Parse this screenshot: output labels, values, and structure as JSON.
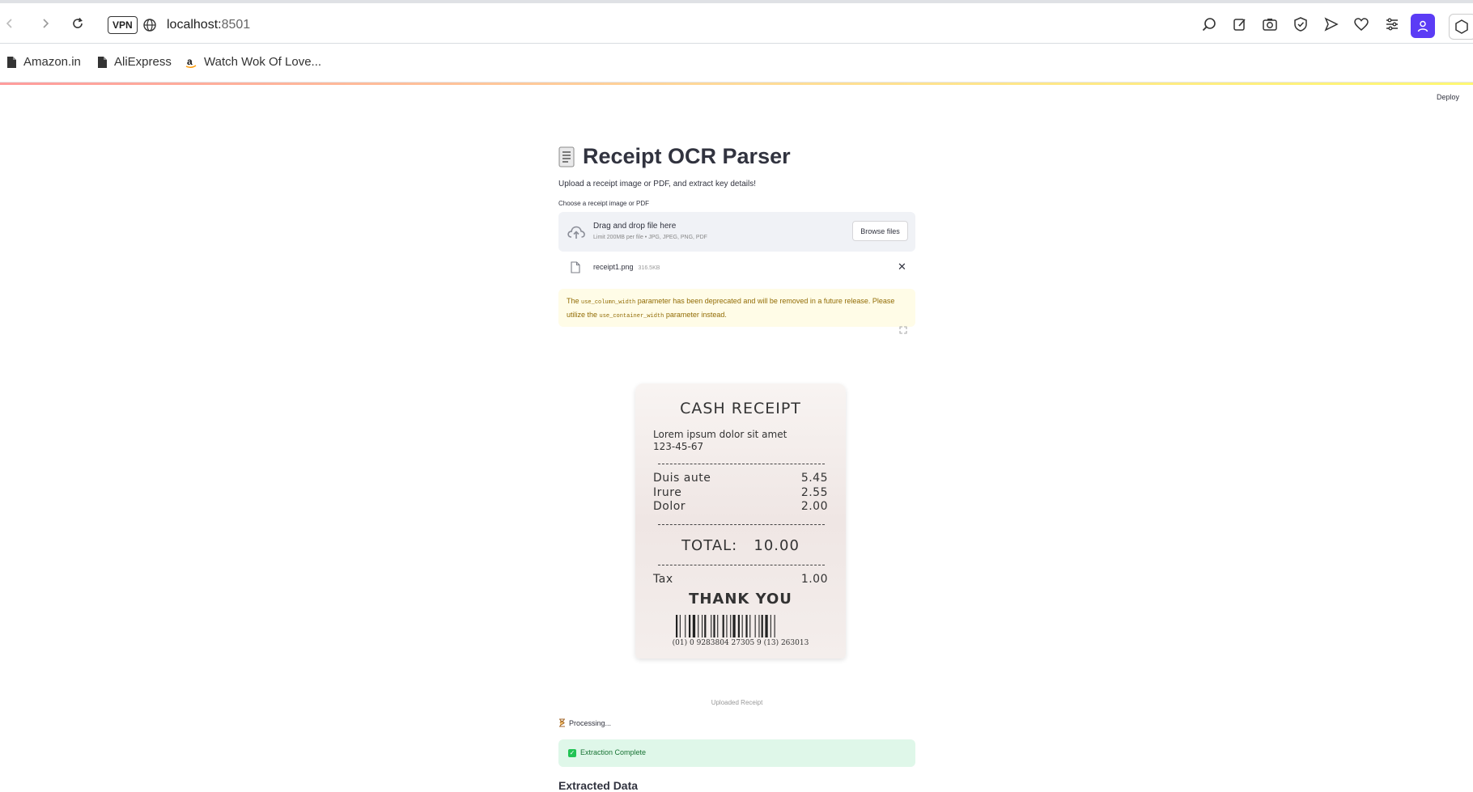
{
  "browser": {
    "vpn_label": "VPN",
    "url_host": "localhost:",
    "url_port": "8501",
    "bookmarks": [
      {
        "label": "Amazon.in",
        "icon": "page-icon"
      },
      {
        "label": "AliExpress",
        "icon": "page-icon"
      },
      {
        "label": "Watch Wok Of Love...",
        "icon": "amazon-icon"
      }
    ]
  },
  "app": {
    "deploy_label": "Deploy",
    "title": "Receipt OCR Parser",
    "subtitle": "Upload a receipt image or PDF, and extract key details!",
    "uploader": {
      "label": "Choose a receipt image or PDF",
      "drag_text": "Drag and drop file here",
      "limit_text": "Limit 200MB per file • JPG, JPEG, PNG, PDF",
      "browse_label": "Browse files"
    },
    "file": {
      "name": "receipt1.png",
      "size": "316.5KB"
    },
    "warning": {
      "t1": "The ",
      "code1": "use_column_width",
      "t2": " parameter has been deprecated and will be removed in a future release. Please utilize the ",
      "code2": "use_container_width",
      "t3": " parameter instead."
    },
    "receipt": {
      "title": "CASH RECEIPT",
      "line1": "Lorem ipsum dolor sit amet",
      "line2": "123-45-67",
      "items": [
        {
          "name": "Duis aute",
          "price": "5.45"
        },
        {
          "name": "Irure",
          "price": "2.55"
        },
        {
          "name": "Dolor",
          "price": "2.00"
        }
      ],
      "total_label": "TOTAL:",
      "total_value": "10.00",
      "tax_label": "Tax",
      "tax_value": "1.00",
      "thanks": "THANK YOU",
      "barcode_text": "(01) 0 9283804 27305 9 (13) 263013"
    },
    "image_caption": "Uploaded Receipt",
    "processing_text": "Processing...",
    "success_text": "Extraction Complete",
    "section_heading": "Extracted Data"
  }
}
